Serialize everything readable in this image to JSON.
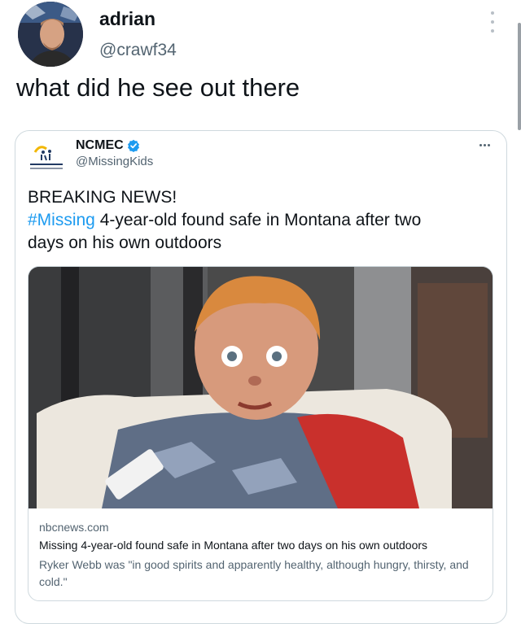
{
  "tweet": {
    "author": {
      "name": "adrian",
      "handle": "@crawf34"
    },
    "text": "what did he see out there"
  },
  "quoted": {
    "author": {
      "name": "NCMEC",
      "handle": "@MissingKids",
      "verified": true
    },
    "text": {
      "line1": "BREAKING NEWS!",
      "hashtag": "#Missing",
      "line2_rest": " 4-year-old found safe in Montana after two",
      "line3": "days on his own outdoors"
    },
    "card": {
      "domain": "nbcnews.com",
      "title": "Missing 4-year-old found safe in Montana after two days on his own outdoors",
      "description": "Ryker Webb was \"in good spirits and apparently healthy, although hungry, thirsty, and cold.\""
    }
  },
  "icons": {
    "more_menu": "vertical-dots-icon",
    "quoted_more": "horizontal-dots-icon",
    "verified": "verified-badge-icon"
  },
  "colors": {
    "link": "#1d9bf0",
    "verified": "#1d9bf0",
    "secondary_text": "#536471",
    "border": "#cfd9de"
  }
}
